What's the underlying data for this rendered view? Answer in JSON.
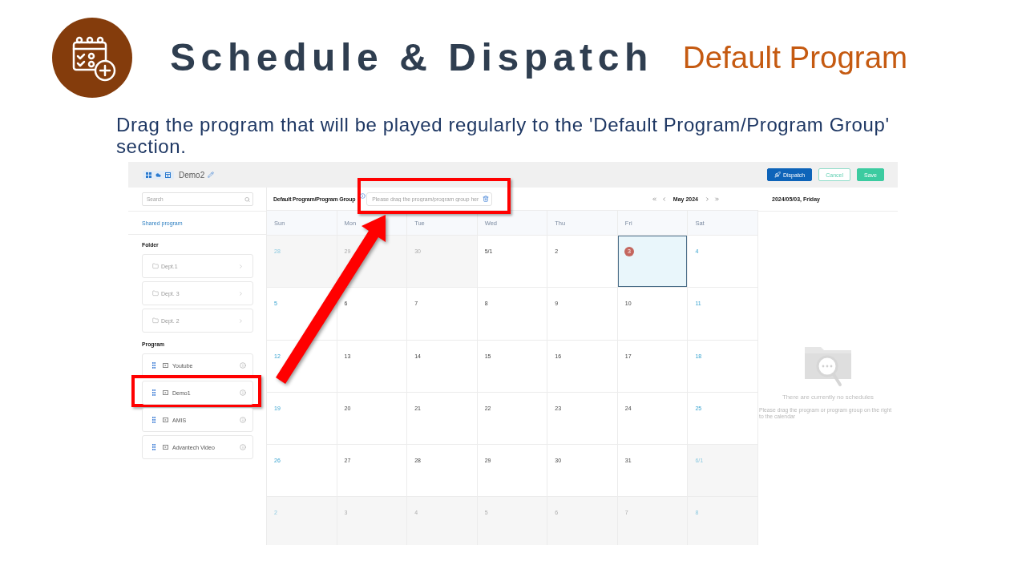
{
  "slide": {
    "title": "Schedule & Dispatch",
    "subtitle": "Default Program",
    "description": "Drag the program that will be played regularly to the 'Default Program/Program Group' section."
  },
  "app": {
    "toolbar": {
      "title": "Demo2",
      "buttons": [
        {
          "label": "Dispatch",
          "kind": "primary"
        },
        {
          "label": "Cancel",
          "kind": "outline"
        },
        {
          "label": "Save",
          "kind": "success"
        }
      ]
    },
    "sidebar": {
      "search": {
        "placeholder": "Search"
      },
      "shared_link": "Shared program",
      "folder_heading": "Folder",
      "folders": [
        {
          "name": "Dept.1"
        },
        {
          "name": "Dept. 3"
        },
        {
          "name": "Dept. 2"
        }
      ],
      "program_heading": "Program",
      "programs": [
        {
          "name": "Youtube",
          "highlighted": false
        },
        {
          "name": "Demo1",
          "highlighted": true
        },
        {
          "name": "AMIS",
          "highlighted": false
        },
        {
          "name": "Advantech Video",
          "highlighted": false
        }
      ]
    },
    "calendar": {
      "default_program": {
        "label": "Default Program/Program Group",
        "placeholder": "Please drag the program/program group her",
        "highlighted": true
      },
      "month": "May 2024",
      "weekdays": [
        "Sun",
        "Mon",
        "Tue",
        "Wed",
        "Thu",
        "Fri",
        "Sat"
      ],
      "weeks": [
        [
          {
            "label": "28",
            "in_month": false,
            "selected": false
          },
          {
            "label": "29",
            "in_month": false,
            "selected": false
          },
          {
            "label": "30",
            "in_month": false,
            "selected": false
          },
          {
            "label": "5/1",
            "in_month": true,
            "selected": false
          },
          {
            "label": "2",
            "in_month": true,
            "selected": false
          },
          {
            "label": "3",
            "in_month": true,
            "selected": true
          },
          {
            "label": "4",
            "in_month": true,
            "selected": false
          }
        ],
        [
          {
            "label": "5",
            "in_month": true,
            "selected": false
          },
          {
            "label": "6",
            "in_month": true,
            "selected": false
          },
          {
            "label": "7",
            "in_month": true,
            "selected": false
          },
          {
            "label": "8",
            "in_month": true,
            "selected": false
          },
          {
            "label": "9",
            "in_month": true,
            "selected": false
          },
          {
            "label": "10",
            "in_month": true,
            "selected": false
          },
          {
            "label": "11",
            "in_month": true,
            "selected": false
          }
        ],
        [
          {
            "label": "12",
            "in_month": true,
            "selected": false
          },
          {
            "label": "13",
            "in_month": true,
            "selected": false
          },
          {
            "label": "14",
            "in_month": true,
            "selected": false
          },
          {
            "label": "15",
            "in_month": true,
            "selected": false
          },
          {
            "label": "16",
            "in_month": true,
            "selected": false
          },
          {
            "label": "17",
            "in_month": true,
            "selected": false
          },
          {
            "label": "18",
            "in_month": true,
            "selected": false
          }
        ],
        [
          {
            "label": "19",
            "in_month": true,
            "selected": false
          },
          {
            "label": "20",
            "in_month": true,
            "selected": false
          },
          {
            "label": "21",
            "in_month": true,
            "selected": false
          },
          {
            "label": "22",
            "in_month": true,
            "selected": false
          },
          {
            "label": "23",
            "in_month": true,
            "selected": false
          },
          {
            "label": "24",
            "in_month": true,
            "selected": false
          },
          {
            "label": "25",
            "in_month": true,
            "selected": false
          }
        ],
        [
          {
            "label": "26",
            "in_month": true,
            "selected": false
          },
          {
            "label": "27",
            "in_month": true,
            "selected": false
          },
          {
            "label": "28",
            "in_month": true,
            "selected": false
          },
          {
            "label": "29",
            "in_month": true,
            "selected": false
          },
          {
            "label": "30",
            "in_month": true,
            "selected": false
          },
          {
            "label": "31",
            "in_month": true,
            "selected": false
          },
          {
            "label": "6/1",
            "in_month": false,
            "selected": false
          }
        ],
        [
          {
            "label": "2",
            "in_month": false,
            "selected": false
          },
          {
            "label": "3",
            "in_month": false,
            "selected": false
          },
          {
            "label": "4",
            "in_month": false,
            "selected": false
          },
          {
            "label": "5",
            "in_month": false,
            "selected": false
          },
          {
            "label": "6",
            "in_month": false,
            "selected": false
          },
          {
            "label": "7",
            "in_month": false,
            "selected": false
          },
          {
            "label": "8",
            "in_month": false,
            "selected": false
          }
        ]
      ]
    },
    "detail": {
      "date": "2024/05/03, Friday",
      "empty_title": "There are currently no schedules",
      "empty_hint": "Please drag the program or program group on the right to the calendar"
    }
  }
}
